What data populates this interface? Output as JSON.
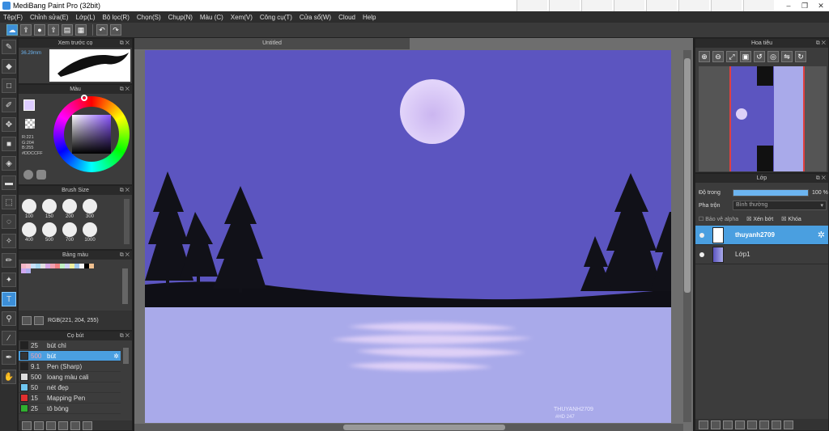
{
  "window": {
    "title": "MediBang Paint Pro (32bit)",
    "min": "–",
    "max": "❐",
    "close": "✕"
  },
  "menu": [
    "Tệp(F)",
    "Chỉnh sửa(E)",
    "Lớp(L)",
    "Bộ lọc(R)",
    "Chọn(S)",
    "Chụp(N)",
    "Màu (C)",
    "Xem(V)",
    "Công cụ(T)",
    "Cửa sổ(W)",
    "Cloud",
    "Help"
  ],
  "preview": {
    "title": "Xem trước cọ",
    "size": "36.29mm"
  },
  "color": {
    "title": "Màu",
    "r": "R:221",
    "g": "G:204",
    "b": "B:255",
    "hex": "#DDCCFF",
    "primary": "#ddccff"
  },
  "brush_size": {
    "title": "Brush Size",
    "sizes": [
      "100",
      "150",
      "200",
      "300",
      "400",
      "500",
      "700",
      "1000"
    ]
  },
  "palette": {
    "title": "Bảng màu",
    "rgb": "RGB(221, 204, 255)",
    "colors": [
      "#f5b8c8",
      "#f8c6d4",
      "#c8e0f8",
      "#a8d8f0",
      "#e0e0e0",
      "#d8a8e8",
      "#f0a0b0",
      "#f08080",
      "#c0f0c0",
      "#d0d0f8",
      "#f0f0a0",
      "#a0c8f0",
      "#f8f8f8",
      "#000000",
      "#f0c090",
      "#d0a8f0",
      "#b0b0f0"
    ]
  },
  "brushes": {
    "title": "Cọ bút",
    "items": [
      {
        "size": "25",
        "name": "bút chì",
        "color": "#222222"
      },
      {
        "size": "500",
        "name": "bút",
        "color": "#333333"
      },
      {
        "size": "9.1",
        "name": "Pen (Sharp)",
        "color": "#222222"
      },
      {
        "size": "500",
        "name": "loang màu cali",
        "color": "#dddddd"
      },
      {
        "size": "50",
        "name": "nét đẹp",
        "color": "#6ec6f0"
      },
      {
        "size": "15",
        "name": "Mapping Pen",
        "color": "#e03030"
      },
      {
        "size": "25",
        "name": "tô bóng",
        "color": "#30b030"
      }
    ]
  },
  "document": {
    "tab": "Untitled",
    "watermark_line1": "THUYANH2709",
    "watermark_line2": "#HD 247"
  },
  "navigator": {
    "title": "Hoa tiêu"
  },
  "layers": {
    "title": "Lớp",
    "opacity_label": "Độ trong",
    "opacity_value": "100 %",
    "opacity": 1.0,
    "blend_label": "Pha trộn",
    "blend_value": "Bình thường",
    "protect_alpha": "Bảo vệ alpha",
    "clipping": "Xén bớt",
    "lock": "Khóa",
    "items": [
      {
        "name": "thuyanh2709",
        "selected": true
      },
      {
        "name": "Lớp1",
        "selected": false
      }
    ]
  },
  "colors": {
    "accent": "#4a9fe0",
    "sky": "#5c55c0",
    "water": "#a9aaea",
    "moon": "#ddd0f8"
  }
}
